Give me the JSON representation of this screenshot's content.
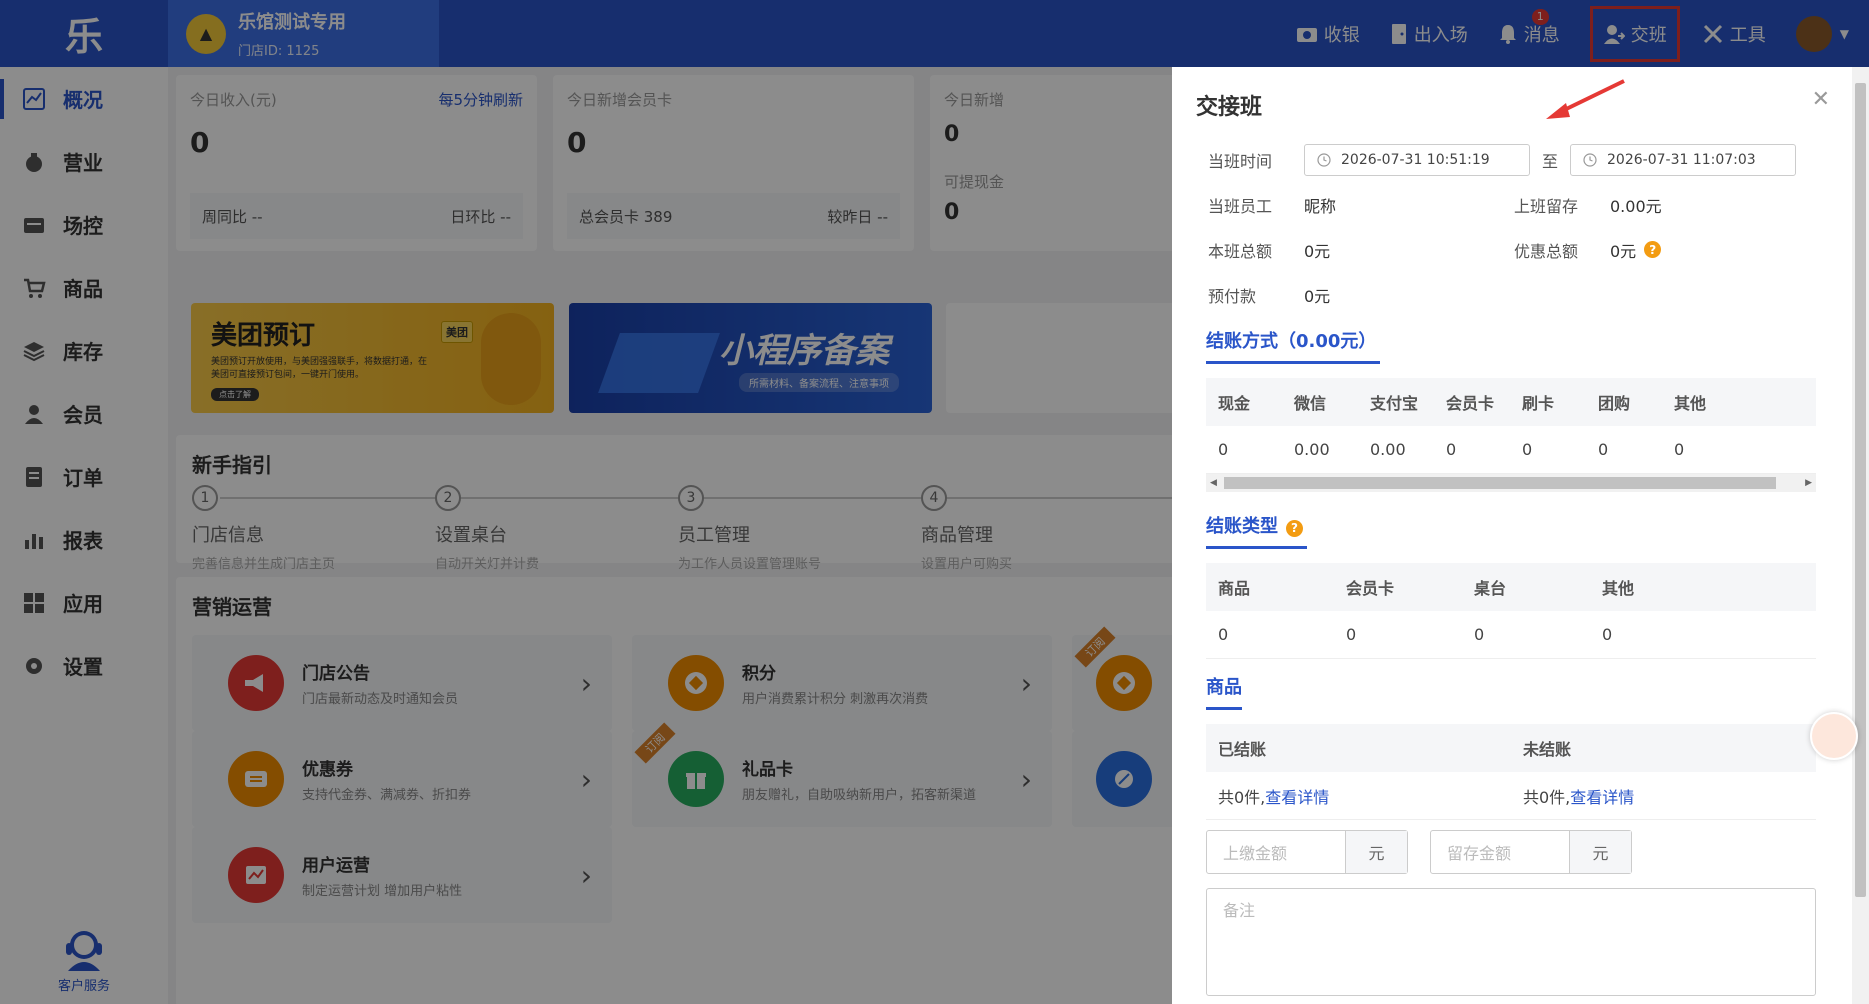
{
  "app": {
    "logo": "乐"
  },
  "store": {
    "name": "乐馆测试专用",
    "id_label": "门店ID: 1125"
  },
  "top_menu": {
    "cashier": "收银",
    "entry_exit": "出入场",
    "messages": "消息",
    "messages_badge": "1",
    "shift": "交班",
    "tools": "工具"
  },
  "sidebar": {
    "items": [
      {
        "label": "概况",
        "icon": "chart-line-icon"
      },
      {
        "label": "营业",
        "icon": "money-bag-icon"
      },
      {
        "label": "场控",
        "icon": "venue-icon"
      },
      {
        "label": "商品",
        "icon": "cart-icon"
      },
      {
        "label": "库存",
        "icon": "layers-icon"
      },
      {
        "label": "会员",
        "icon": "user-icon"
      },
      {
        "label": "订单",
        "icon": "order-icon"
      },
      {
        "label": "报表",
        "icon": "bar-chart-icon"
      },
      {
        "label": "应用",
        "icon": "apps-icon"
      },
      {
        "label": "设置",
        "icon": "gear-icon"
      }
    ],
    "customer_service": "客户服务"
  },
  "dashboard": {
    "income": {
      "title": "今日收入(元)",
      "refresh": "每5分钟刷新",
      "value": "0",
      "wow": "周同比 --",
      "dod": "日环比 --"
    },
    "new_members": {
      "title": "今日新增会员卡",
      "value": "0",
      "total": "总会员卡 389",
      "compare": "较昨日 --"
    },
    "third": {
      "title": "今日新增",
      "value": "0",
      "title2": "可提现金",
      "value2": "0"
    },
    "banners": {
      "meituan_title": "美团预订",
      "meituan_desc": "美团预订开放使用，与美团强强联手，将数据打通，在美团可直接预订包间，一键开门使用。",
      "meituan_badge": "美团",
      "meituan_btn": "点击了解",
      "miniapp_title": "小程序备案",
      "miniapp_desc": "所需材料、备案流程、注意事项"
    },
    "guide": {
      "title": "新手指引",
      "steps": [
        {
          "num": "1",
          "title": "门店信息",
          "desc": "完善信息并生成门店主页"
        },
        {
          "num": "2",
          "title": "设置桌台",
          "desc": "自动开关灯并计费"
        },
        {
          "num": "3",
          "title": "员工管理",
          "desc": "为工作人员设置管理账号"
        },
        {
          "num": "4",
          "title": "商品管理",
          "desc": "设置用户可购买"
        }
      ]
    },
    "marketing": {
      "title": "营销运营",
      "items": [
        {
          "title": "门店公告",
          "desc": "门店最新动态及时通知会员"
        },
        {
          "title": "积分",
          "desc": "用户消费累计积分 刺激再次消费"
        },
        {
          "title": "优惠券",
          "desc": "支持代金券、满减券、折扣券"
        },
        {
          "title": "礼品卡",
          "desc": "朋友赠礼，自助吸纳新用户，拓客新渠道"
        },
        {
          "title": "用户运营",
          "desc": "制定运营计划 增加用户粘性"
        }
      ],
      "subscribe_tag": "订阅"
    }
  },
  "shift_drawer": {
    "title": "交接班",
    "time_label": "当班时间",
    "start_time": "2026-07-31 10:51:19",
    "to": "至",
    "end_time": "2026-07-31 11:07:03",
    "staff_label": "当班员工",
    "staff_value": "昵称",
    "prev_label": "上班留存",
    "prev_value": "0.00元",
    "total_label": "本班总额",
    "total_value": "0元",
    "discount_label": "优惠总额",
    "discount_value": "0元",
    "prepay_label": "预付款",
    "prepay_value": "0元",
    "payment_tab": "结账方式（0.00元）",
    "payment_headers": [
      "现金",
      "微信",
      "支付宝",
      "会员卡",
      "刷卡",
      "团购",
      "其他"
    ],
    "payment_values": [
      "0",
      "0.00",
      "0.00",
      "0",
      "0",
      "0",
      "0"
    ],
    "type_tab": "结账类型",
    "type_headers": [
      "商品",
      "会员卡",
      "桌台",
      "其他"
    ],
    "type_values": [
      "0",
      "0",
      "0",
      "0"
    ],
    "goods_tab": "商品",
    "goods_headers": [
      "已结账",
      "未结账"
    ],
    "settled_text": "共0件,",
    "unsettled_text": "共0件,",
    "detail_link": "查看详情",
    "handover_placeholder": "上缴金额",
    "retain_placeholder": "留存金额",
    "unit": "元",
    "remark_placeholder": "备注"
  }
}
